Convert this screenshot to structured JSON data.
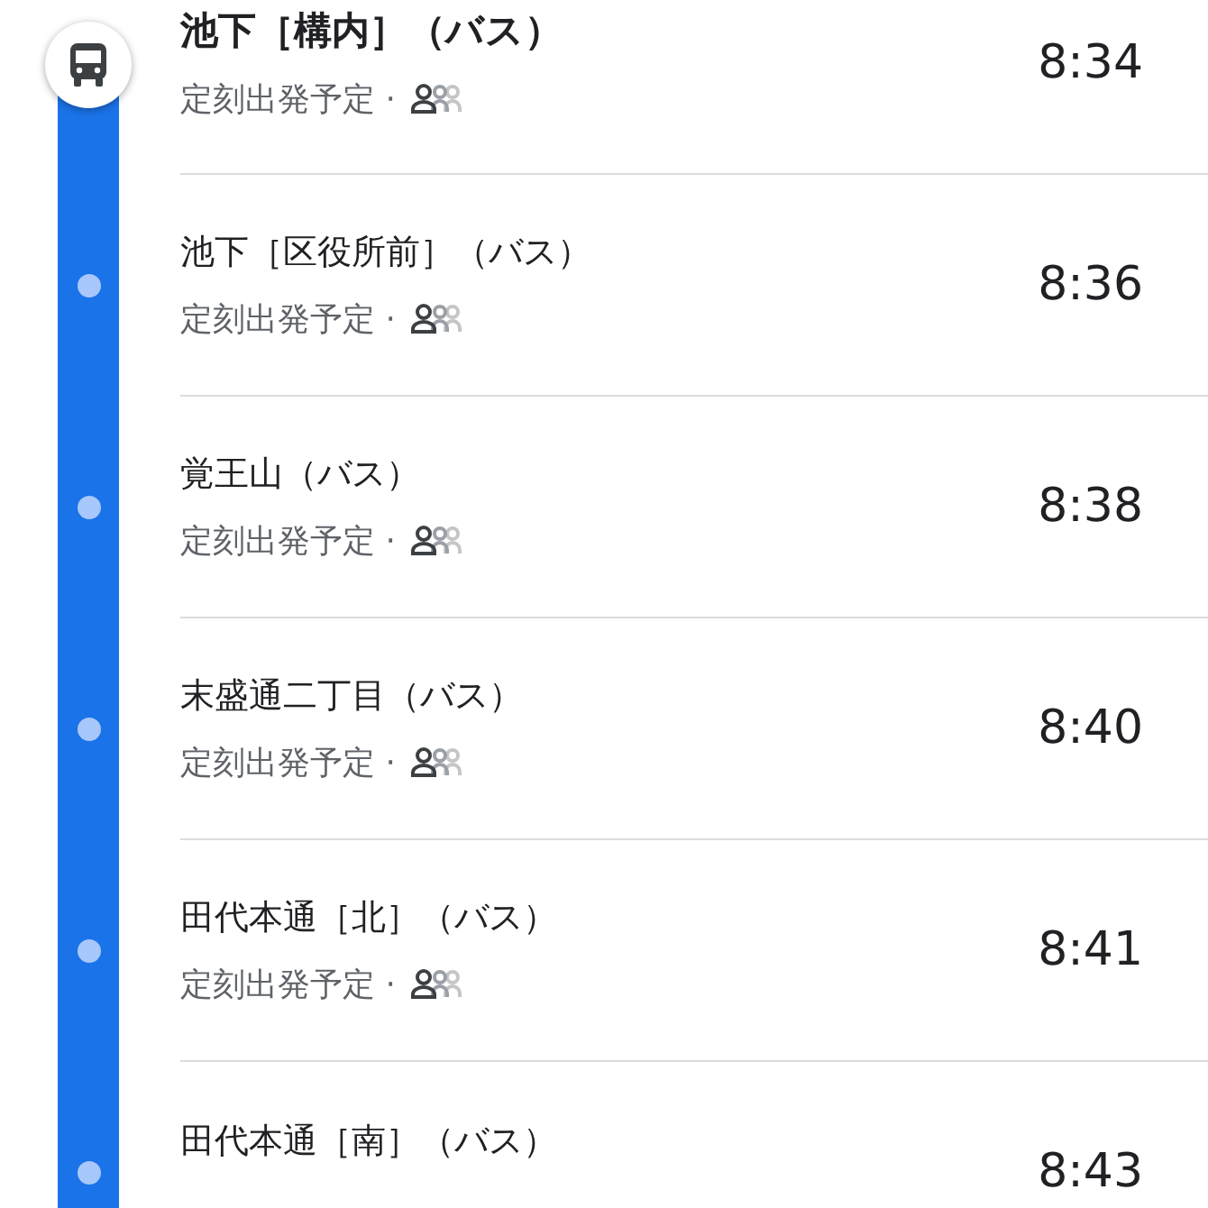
{
  "stops": [
    {
      "kind": "origin",
      "name": "池下［構内］（バス）",
      "status": "定刻出発予定 ·",
      "time": "8:34"
    },
    {
      "kind": "stop",
      "name": "池下［区役所前］（バス）",
      "status": "定刻出発予定 ·",
      "time": "8:36"
    },
    {
      "kind": "stop",
      "name": "覚王山（バス）",
      "status": "定刻出発予定 ·",
      "time": "8:38"
    },
    {
      "kind": "stop",
      "name": "末盛通二丁目（バス）",
      "status": "定刻出発予定 ·",
      "time": "8:40"
    },
    {
      "kind": "stop",
      "name": "田代本通［北］（バス）",
      "status": "定刻出発予定 ·",
      "time": "8:41"
    },
    {
      "kind": "stop",
      "name": "田代本通［南］（バス）",
      "time": "8:43"
    }
  ]
}
